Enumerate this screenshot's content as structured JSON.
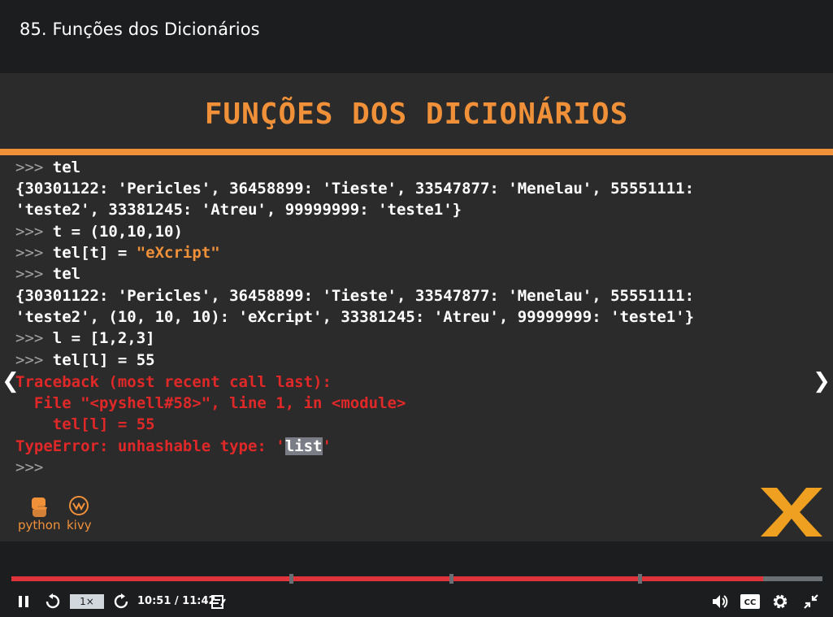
{
  "header": {
    "lecture_title": "85. Funções dos Dicionários"
  },
  "slide": {
    "heading": "FUNÇÕES DOS DICIONÁRIOS",
    "shell_lines": [
      {
        "prompt": ">>>",
        "text": " tel"
      },
      {
        "text": "{30301122: 'Pericles', 36458899: 'Tieste', 33547877: 'Menelau', 55551111:"
      },
      {
        "text": "'teste2', 33381245: 'Atreu', 99999999: 'teste1'}"
      },
      {
        "prompt": ">>>",
        "text": " t = (10,10,10)"
      },
      {
        "prompt": ">>>",
        "text": " tel[t] = ",
        "string": "\"eXcript\""
      },
      {
        "prompt": ">>>",
        "text": " tel"
      },
      {
        "text": "{30301122: 'Pericles', 36458899: 'Tieste', 33547877: 'Menelau', 55551111:"
      },
      {
        "text": "'teste2', (10, 10, 10): 'eXcript', 33381245: 'Atreu', 99999999: 'teste1'}"
      },
      {
        "prompt": ">>>",
        "text": " l = [1,2,3]"
      },
      {
        "prompt": ">>>",
        "text": " tel[l] = 55"
      },
      {
        "error": "Traceback (most recent call last):"
      },
      {
        "error": "  File \"<pyshell#58>\", line 1, in <module>"
      },
      {
        "error": "    tel[l] = 55"
      },
      {
        "error": "TypeError: unhashable type: '",
        "selected": "list",
        "error_end": "'"
      },
      {
        "prompt": ">>>",
        "text": ""
      }
    ],
    "logos": {
      "python": "python",
      "kivy": "kivy"
    }
  },
  "player": {
    "speed_label": "1×",
    "time_display": "10:51 / 11:42",
    "progress": 0.927,
    "chapter_marks": [
      0.345,
      0.542,
      0.775
    ],
    "colors": {
      "accent": "#f0913a",
      "progress": "#e0333a",
      "error": "#e02828"
    }
  }
}
